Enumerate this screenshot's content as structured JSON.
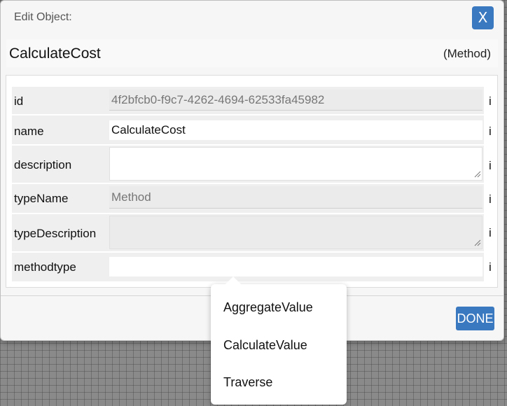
{
  "dialog": {
    "title": "Edit Object:",
    "close_label": "X",
    "object_name": "CalculateCost",
    "object_type": "(Method)",
    "done_label": "DONE"
  },
  "properties": [
    {
      "label": "id",
      "value": "4f2bfcb0-f9c7-4262-4694-62533fa45982",
      "info": "i"
    },
    {
      "label": "name",
      "value": "CalculateCost",
      "info": "i"
    },
    {
      "label": "description",
      "value": "",
      "info": "i"
    },
    {
      "label": "typeName",
      "value": "Method",
      "info": "i"
    },
    {
      "label": "typeDescription",
      "value": "",
      "info": "i"
    },
    {
      "label": "methodtype",
      "value": "",
      "info": "i"
    }
  ],
  "methodtype_options": [
    "AggregateValue",
    "CalculateValue",
    "Traverse"
  ],
  "colors": {
    "accent": "#3a78bf"
  }
}
